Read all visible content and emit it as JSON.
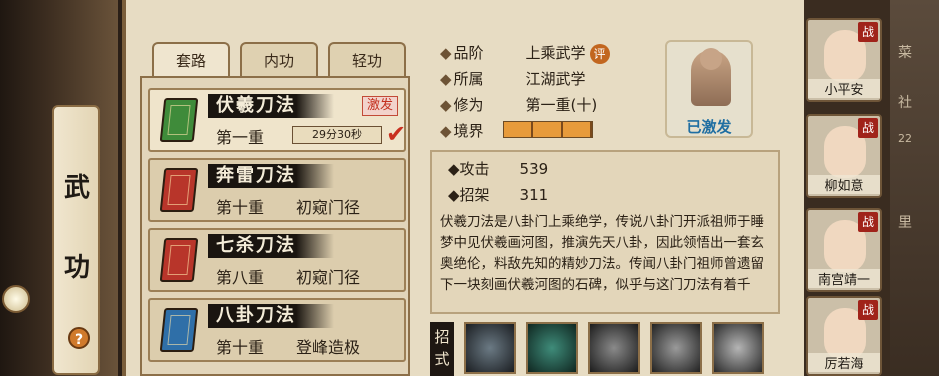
{
  "sidebar": {
    "title_chars": [
      "武",
      "功"
    ],
    "help": "?"
  },
  "tabs": [
    {
      "label": "套路"
    },
    {
      "label": "内功"
    },
    {
      "label": "轻功"
    }
  ],
  "skills": [
    {
      "name": "伏羲刀法",
      "level": "第一重",
      "badge": "激发",
      "timer": "29分30秒",
      "book_color": "#3f8b3a"
    },
    {
      "name": "奔雷刀法",
      "level": "第十重",
      "desc": "初窥门径",
      "book_color": "#b8352a"
    },
    {
      "name": "七杀刀法",
      "level": "第八重",
      "desc": "初窥门径",
      "book_color": "#b8352a"
    },
    {
      "name": "八卦刀法",
      "level": "第十重",
      "desc": "登峰造极",
      "book_color": "#2f6fa8"
    }
  ],
  "detail": {
    "grade_label": "品阶",
    "grade_value": "上乘武学",
    "rate": "评",
    "belong_label": "所属",
    "belong_value": "江湖武学",
    "cultivate_label": "修为",
    "cultivate_value": "第一重(十)",
    "realm_label": "境界",
    "realm_level": 3,
    "activated": "已激发",
    "attack_label": "攻击",
    "attack_value": "539",
    "parry_label": "招架",
    "parry_value": "311",
    "description": "伏羲刀法是八卦门上乘绝学，传说八卦门开派祖师于睡梦中见伏羲画河图，推演先天八卦，因此领悟出一套玄奥绝伦，料敌先知的精妙刀法。传闻八卦门祖师曾遗留下一块刻画伏羲河图的石碑，似乎与这门刀法有着千",
    "moves_label": "招式"
  },
  "characters": [
    {
      "name": "小平安",
      "tag": "战"
    },
    {
      "name": "柳如意",
      "tag": "战"
    },
    {
      "name": "南宫靖一",
      "tag": "战"
    },
    {
      "name": "厉若海",
      "tag": "战"
    }
  ],
  "right_edge": [
    "菜",
    "社",
    "22",
    "里"
  ],
  "colors": {
    "accent": "#c2661f",
    "activated": "#1f6ea2",
    "battle": "#a0231a"
  }
}
